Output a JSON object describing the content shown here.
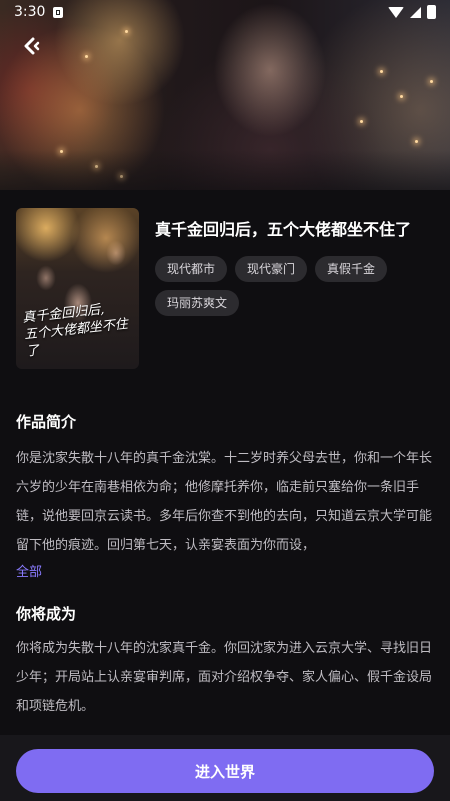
{
  "status_bar": {
    "time": "3:30"
  },
  "book": {
    "title": "真千金回归后，五个大佬都坐不住了",
    "cover_title_line1": "真千金回归后,",
    "cover_title_line2": "五个大佬都坐不住了",
    "tags": [
      "现代都市",
      "现代豪门",
      "真假千金",
      "玛丽苏爽文"
    ]
  },
  "intro": {
    "heading": "作品简介",
    "text": "你是沈家失散十八年的真千金沈棠。十二岁时养父母去世，你和一个年长六岁的少年在南巷相依为命；他修摩托养你，临走前只塞给你一条旧手链，说他要回京云读书。多年后你查不到他的去向，只知道云京大学可能留下他的痕迹。回归第七天，认亲宴表面为你而设，",
    "expand_label": "全部"
  },
  "role": {
    "heading": "你将成为",
    "text": "你将成为失散十八年的沈家真千金。你回沈家为进入云京大学、寻找旧日少年；开局站上认亲宴审判席，面对介绍权争夺、家人偏心、假千金设局和项链危机。"
  },
  "action": {
    "enter_label": "进入世界"
  },
  "colors": {
    "accent": "#7f6cf2",
    "link": "#8a7bff",
    "background": "#0f0e11"
  }
}
